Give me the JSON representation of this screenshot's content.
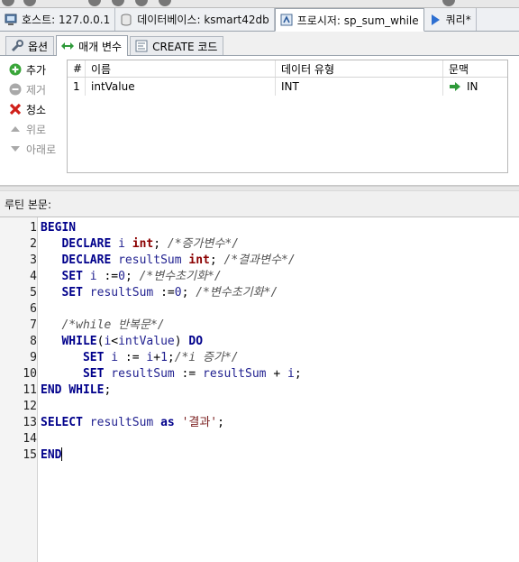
{
  "doc_tabs": [
    {
      "label": "호스트: 127.0.0.1",
      "icon": "host-icon"
    },
    {
      "label": "데이터베이스: ksmart42db",
      "icon": "database-icon"
    },
    {
      "label": "프로시저: sp_sum_while",
      "icon": "procedure-icon",
      "active": true
    },
    {
      "label": "쿼리*",
      "icon": "query-icon"
    }
  ],
  "sub_tabs": [
    {
      "label": "옵션",
      "icon": "wrench-icon"
    },
    {
      "label": "매개 변수",
      "icon": "arrows-icon",
      "active": true
    },
    {
      "label": "CREATE 코드",
      "icon": "code-icon"
    }
  ],
  "actions": {
    "add": "추가",
    "remove": "제거",
    "clear": "청소",
    "up": "위로",
    "down": "아래로"
  },
  "param_grid": {
    "headers": [
      "#",
      "이름",
      "데이터 유형",
      "문맥"
    ],
    "rows": [
      {
        "num": "1",
        "name": "intValue",
        "type": "INT",
        "context": "IN"
      }
    ]
  },
  "body_label": "루틴 본문:",
  "code_lines": [
    {
      "n": "1",
      "src": "BEGIN"
    },
    {
      "n": "2",
      "src": "   DECLARE i int; /*증가변수*/"
    },
    {
      "n": "3",
      "src": "   DECLARE resultSum int; /*결과변수*/"
    },
    {
      "n": "4",
      "src": "   SET i :=0; /*변수초기화*/"
    },
    {
      "n": "5",
      "src": "   SET resultSum :=0; /*변수초기화*/"
    },
    {
      "n": "6",
      "src": ""
    },
    {
      "n": "7",
      "src": "   /*while 반복문*/"
    },
    {
      "n": "8",
      "src": "   WHILE(i<intValue) DO"
    },
    {
      "n": "9",
      "src": "      SET i := i+1;/*i 증가*/"
    },
    {
      "n": "10",
      "src": "      SET resultSum := resultSum + i;"
    },
    {
      "n": "11",
      "src": "END WHILE;"
    },
    {
      "n": "12",
      "src": ""
    },
    {
      "n": "13",
      "src": "SELECT resultSum as '결과';"
    },
    {
      "n": "14",
      "src": ""
    },
    {
      "n": "15",
      "src": "END"
    }
  ],
  "colors": {
    "keyword": "#00008b",
    "type": "#8b0000",
    "comment": "#555555",
    "add_green": "#2e9b2e",
    "clear_red": "#d0201a"
  }
}
